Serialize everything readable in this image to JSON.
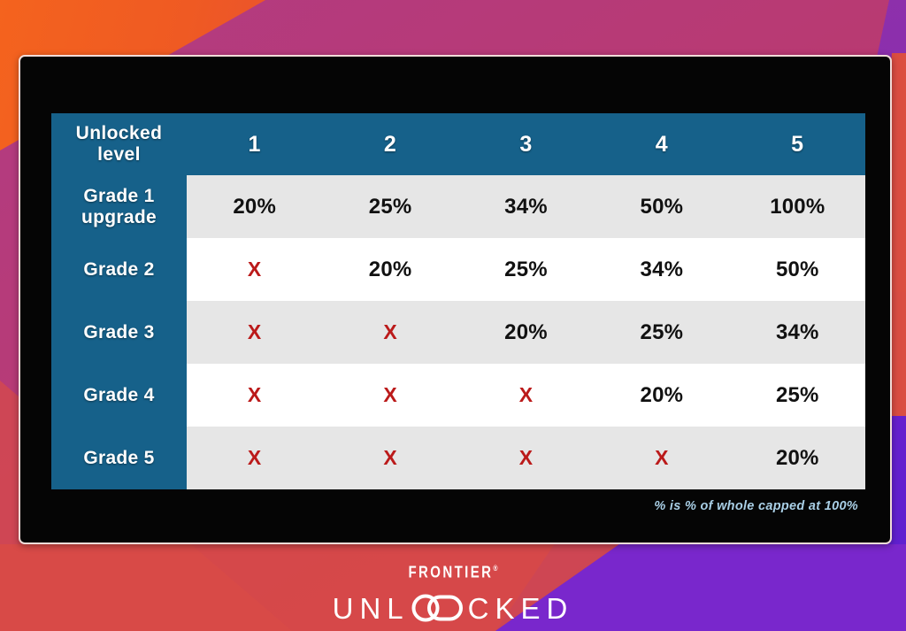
{
  "background": {
    "gradient_start": "#f4631e",
    "gradient_end": "#b0399b",
    "wedge_magenta": "#a03a8e",
    "wedge_purple": "#6d21c8",
    "wedge_red": "#e0503f"
  },
  "panel": {
    "background": "#050505",
    "border_color": "#f2dcd9"
  },
  "table": {
    "header_bg": "#16618a",
    "row_alt_bg": "#e6e6e6",
    "row_bg": "#ffffff",
    "x_color": "#bb1a1a",
    "corner_label_line1": "Unlocked",
    "corner_label_line2": "level",
    "columns": [
      "1",
      "2",
      "3",
      "4",
      "5"
    ],
    "rows": [
      {
        "label_line1": "Grade 1",
        "label_line2": "upgrade",
        "cells": [
          "20%",
          "25%",
          "34%",
          "50%",
          "100%"
        ]
      },
      {
        "label_line1": "Grade 2",
        "label_line2": "",
        "cells": [
          "X",
          "20%",
          "25%",
          "34%",
          "50%"
        ]
      },
      {
        "label_line1": "Grade 3",
        "label_line2": "",
        "cells": [
          "X",
          "X",
          "20%",
          "25%",
          "34%"
        ]
      },
      {
        "label_line1": "Grade 4",
        "label_line2": "",
        "cells": [
          "X",
          "X",
          "X",
          "20%",
          "25%"
        ]
      },
      {
        "label_line1": "Grade 5",
        "label_line2": "",
        "cells": [
          "X",
          "X",
          "X",
          "X",
          "20%"
        ]
      }
    ]
  },
  "footnote": {
    "text": "% is % of whole capped at 100%",
    "color": "#a9cfe6"
  },
  "logo": {
    "brand": "FRONTIER",
    "trademark": "®",
    "word_before": "UNL",
    "word_after": "CKED",
    "chain_icon": "chain-link-icon"
  }
}
